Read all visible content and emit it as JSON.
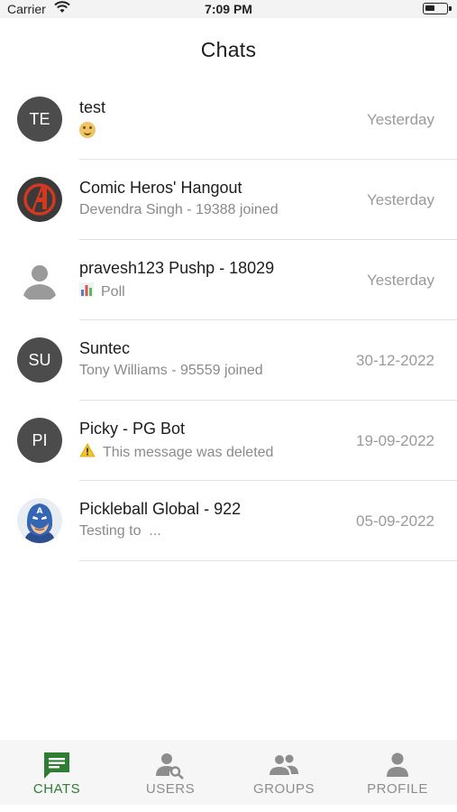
{
  "status_bar": {
    "carrier": "Carrier",
    "time": "7:09 PM"
  },
  "header": {
    "title": "Chats"
  },
  "colors": {
    "accent": "#2e7d32",
    "avatar_bg": "#4c4c4c",
    "tab_inactive": "#8d8d8d"
  },
  "chats": [
    {
      "avatar_initials": "TE",
      "avatar_type": "initials",
      "name": "test",
      "preview": "",
      "preview_icon": "smile-emoji-icon",
      "time": "Yesterday"
    },
    {
      "avatar_initials": "",
      "avatar_type": "avengers-logo",
      "name": "Comic Heros' Hangout",
      "preview": "Devendra Singh - 19388 joined",
      "preview_icon": "",
      "time": "Yesterday"
    },
    {
      "avatar_initials": "",
      "avatar_type": "default-user",
      "name": "pravesh123 Pushp - 18029",
      "preview": "Poll",
      "preview_icon": "poll-chart-icon",
      "time": "Yesterday"
    },
    {
      "avatar_initials": "SU",
      "avatar_type": "initials",
      "name": "Suntec",
      "preview": "Tony Williams - 95559 joined",
      "preview_icon": "",
      "time": "30-12-2022"
    },
    {
      "avatar_initials": "PI",
      "avatar_type": "initials",
      "name": "Picky - PG Bot",
      "preview": "This message was deleted",
      "preview_icon": "warning-icon",
      "time": "19-09-2022"
    },
    {
      "avatar_initials": "",
      "avatar_type": "captain-america",
      "name": "Pickleball Global - 922",
      "preview": "Testing to  ...",
      "preview_icon": "",
      "time": "05-09-2022"
    }
  ],
  "tabs": [
    {
      "label": "CHATS",
      "icon": "chat-bubble-icon",
      "active": true
    },
    {
      "label": "USERS",
      "icon": "user-search-icon",
      "active": false
    },
    {
      "label": "GROUPS",
      "icon": "groups-icon",
      "active": false
    },
    {
      "label": "PROFILE",
      "icon": "profile-icon",
      "active": false
    }
  ]
}
